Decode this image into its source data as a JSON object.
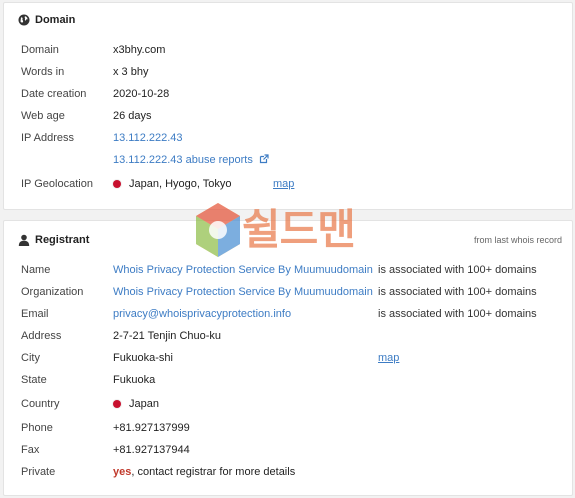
{
  "domain_panel": {
    "title": "Domain",
    "domain_label": "Domain",
    "domain_value": "x3bhy.com",
    "words_label": "Words in",
    "words_value": "x 3 bhy",
    "creation_label": "Date creation",
    "creation_value": "2020-10-28",
    "age_label": "Web age",
    "age_value": "26 days",
    "ip_label": "IP Address",
    "ip_value": "13.112.222.43",
    "abuse_link": "13.112.222.43 abuse reports",
    "geo_label": "IP Geolocation",
    "geo_value": "Japan, Hyogo, Tokyo",
    "geo_map": "map"
  },
  "registrant_panel": {
    "title": "Registrant",
    "note": "from last whois record",
    "name_label": "Name",
    "name_value": "Whois Privacy Protection Service By Muumuudomain",
    "name_assoc": "is associated with 100+ domains",
    "org_label": "Organization",
    "org_value": "Whois Privacy Protection Service By Muumuudomain",
    "org_assoc": "is associated with 100+ domains",
    "email_label": "Email",
    "email_value": "privacy@whoisprivacyprotection.info",
    "email_assoc": "is associated with 100+ domains",
    "address_label": "Address",
    "address_value": "2-7-21 Tenjin Chuo-ku",
    "city_label": "City",
    "city_value": "Fukuoka-shi",
    "city_map": "map",
    "state_label": "State",
    "state_value": "Fukuoka",
    "country_label": "Country",
    "country_value": "Japan",
    "phone_label": "Phone",
    "phone_value": "+81.927137999",
    "fax_label": "Fax",
    "fax_value": "+81.927137944",
    "private_label": "Private",
    "private_yes": "yes",
    "private_rest": ", contact registrar for more details"
  },
  "watermark": {
    "text": "쉴드맨"
  },
  "colors": {
    "link": "#3d7cc4",
    "flag_red": "#c8102e",
    "yes_red": "#c0392b"
  },
  "icons": {
    "domain_heading": "globe-icon",
    "registrant_heading": "user-icon",
    "abuse_link": "external-link-icon",
    "flag": "japan-flag-icon"
  }
}
